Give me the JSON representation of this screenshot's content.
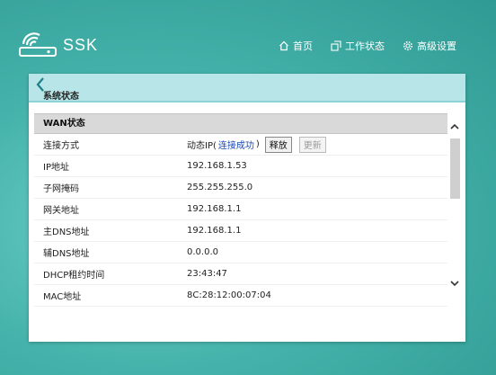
{
  "brand": {
    "logo_text": "SSK"
  },
  "nav": [
    {
      "label": "首页",
      "icon": "home-icon"
    },
    {
      "label": "工作状态",
      "icon": "status-icon"
    },
    {
      "label": "高级设置",
      "icon": "gear-icon"
    }
  ],
  "panel": {
    "title": "系统状态",
    "back_icon": "chevron-left-icon"
  },
  "wan": {
    "section_title": "WAN状态",
    "rows": [
      {
        "label": "连接方式",
        "value": "动态IP(",
        "link": "连接成功",
        "suffix": ")",
        "release_btn": "释放",
        "renew_btn": "更新"
      },
      {
        "label": "IP地址",
        "value": "192.168.1.53"
      },
      {
        "label": "子网掩码",
        "value": "255.255.255.0"
      },
      {
        "label": "网关地址",
        "value": "192.168.1.1"
      },
      {
        "label": "主DNS地址",
        "value": "192.168.1.1"
      },
      {
        "label": "辅DNS地址",
        "value": "0.0.0.0"
      },
      {
        "label": "DHCP租约时间",
        "value": "23:43:47"
      },
      {
        "label": "MAC地址",
        "value": "8C:28:12:00:07:04"
      }
    ]
  },
  "colors": {
    "background": "#45b3ab",
    "header": "#b8e6e8",
    "link": "#1a49b8"
  }
}
